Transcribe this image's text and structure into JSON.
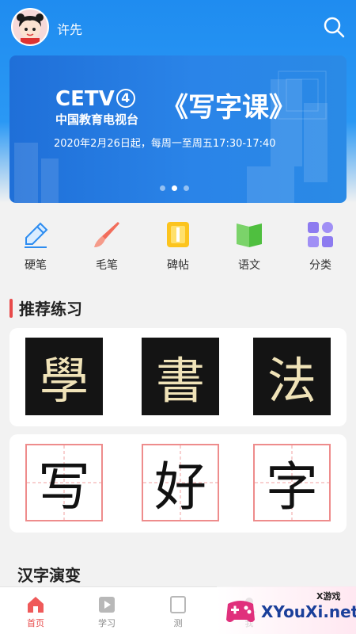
{
  "header": {
    "username": "许先",
    "avatar_icon": "girl-avatar-icon",
    "search_icon": "search-icon"
  },
  "banner": {
    "logo_text": "CETV",
    "logo_num": "4",
    "logo_sub": "中国教育电视台",
    "title": "《写字课》",
    "subtitle": "2020年2月26日起，每周一至周五17:30-17:40",
    "dots": 3,
    "active_dot": 2
  },
  "categories": [
    {
      "label": "硬笔",
      "icon": "pen-icon"
    },
    {
      "label": "毛笔",
      "icon": "brush-icon"
    },
    {
      "label": "碑帖",
      "icon": "book-icon"
    },
    {
      "label": "语文",
      "icon": "open-book-icon"
    },
    {
      "label": "分类",
      "icon": "grid-icon"
    }
  ],
  "recommend": {
    "title": "推荐练习",
    "calligraphy": [
      "學",
      "書",
      "法"
    ],
    "practice": [
      "写",
      "好",
      "字"
    ]
  },
  "evolution": {
    "title": "汉字演变"
  },
  "tabs": [
    {
      "label": "首页",
      "icon": "home-icon",
      "active": true
    },
    {
      "label": "学习",
      "icon": "play-icon",
      "active": false
    },
    {
      "label": "测",
      "icon": "test-icon",
      "active": false
    },
    {
      "label": "我",
      "icon": "user-icon",
      "active": false
    }
  ],
  "watermark": {
    "top": "X游戏",
    "main": "XYouXi.net"
  },
  "colors": {
    "brand_blue": "#1f8cf0",
    "accent_red": "#e84a4a"
  }
}
